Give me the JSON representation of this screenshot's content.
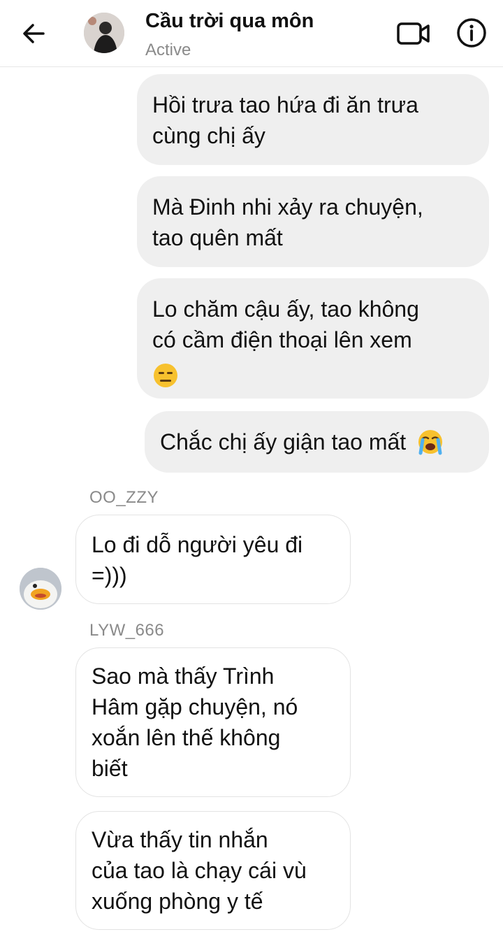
{
  "header": {
    "title": "Cầu trời qua môn",
    "status": "Active"
  },
  "messages": {
    "m1": {
      "line1": "Hồi trưa tao hứa đi ăn trưa",
      "line2": "cùng chị ấy"
    },
    "m2": {
      "line1": "Mà Đinh nhi xảy ra chuyện,",
      "line2": "tao quên mất"
    },
    "m3": {
      "line1": "Lo chăm cậu ấy, tao không",
      "line2": "có cầm điện thoại lên xem",
      "emoji": "expressionless-face-emoji"
    },
    "m4": {
      "text": "Chắc chị ấy giận tao mất",
      "emoji": "loudly-crying-face-emoji"
    },
    "sender1": "OO_ZZY",
    "m5": {
      "line1": "Lo đi dỗ người yêu đi",
      "line2": "=)))"
    },
    "sender2": "LYW_666",
    "m6": {
      "line1": "Sao mà thấy Trình",
      "line2": "Hâm gặp chuyện, nó",
      "line3": "xoắn lên thế không",
      "line4": "biết"
    },
    "m7": {
      "line1": "Vừa thấy tin nhắn",
      "line2": "của tao là chạy cái vù",
      "line3": "xuống phòng y tế"
    }
  },
  "icons": {
    "back": "arrow-left-icon",
    "video": "video-camera-icon",
    "info": "info-icon"
  },
  "colors": {
    "outgoing_bubble": "#efefef",
    "incoming_border": "#e3e3e3",
    "secondary_text": "#8a8a8a"
  }
}
